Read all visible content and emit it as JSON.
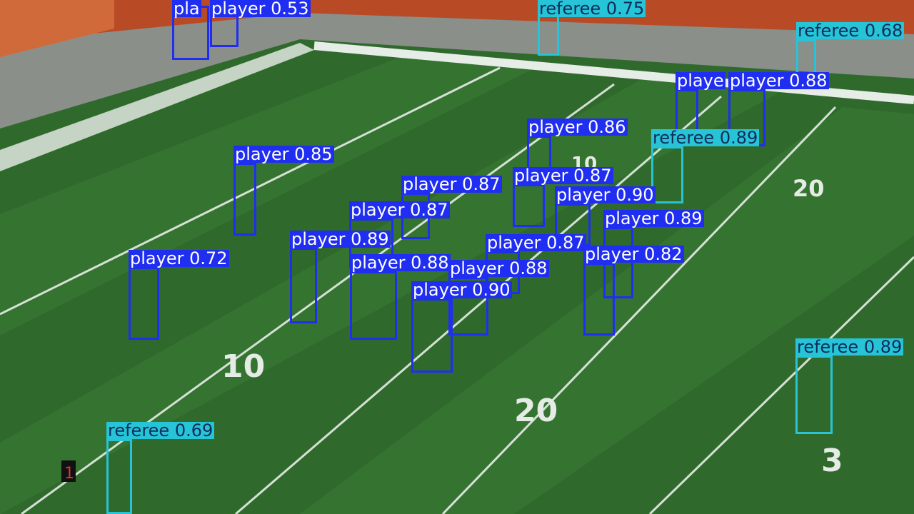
{
  "colors": {
    "player": "#1f2ef0",
    "referee": "#27c4d8",
    "turf_dark": "#2f6a2c",
    "turf_light": "#4d8a40",
    "sideline": "#8a8f8a",
    "stands": "#c0512a"
  },
  "field_numbers": [
    "10",
    "20",
    "10",
    "20",
    "3"
  ],
  "down_marker": "1",
  "detections": [
    {
      "label": "player 0.53",
      "cls": "player"
    },
    {
      "label": "pla",
      "cls": "player"
    },
    {
      "label": "referee 0.75",
      "cls": "referee"
    },
    {
      "label": "referee 0.68",
      "cls": "referee"
    },
    {
      "label": "playe",
      "cls": "player"
    },
    {
      "label": "player 0.88",
      "cls": "player"
    },
    {
      "label": "player 0.86",
      "cls": "player"
    },
    {
      "label": "referee 0.89",
      "cls": "referee"
    },
    {
      "label": "player 0.85",
      "cls": "player"
    },
    {
      "label": "player 0.87",
      "cls": "player"
    },
    {
      "label": "player 0.87",
      "cls": "player"
    },
    {
      "label": "player 0.90",
      "cls": "player"
    },
    {
      "label": "player 0.87",
      "cls": "player"
    },
    {
      "label": "player 0.89",
      "cls": "player"
    },
    {
      "label": "player 0.89",
      "cls": "player"
    },
    {
      "label": "player 0.88",
      "cls": "player"
    },
    {
      "label": "player 0.87",
      "cls": "player"
    },
    {
      "label": "player 0.82",
      "cls": "player"
    },
    {
      "label": "player 0.72",
      "cls": "player"
    },
    {
      "label": "player 0.88",
      "cls": "player"
    },
    {
      "label": "player 0.90",
      "cls": "player"
    },
    {
      "label": "referee 0.89",
      "cls": "referee"
    },
    {
      "label": "referee 0.69",
      "cls": "referee"
    }
  ]
}
